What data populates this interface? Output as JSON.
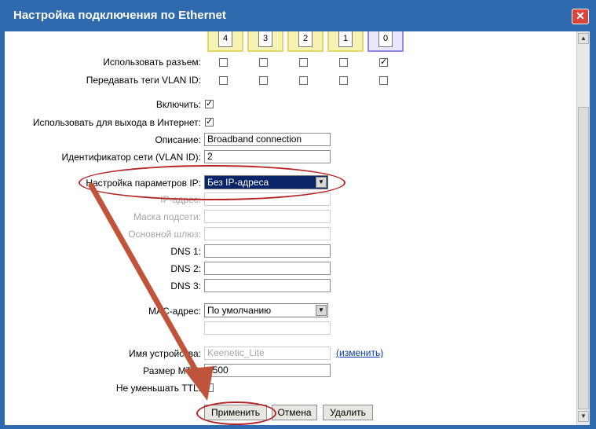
{
  "window": {
    "title": "Настройка подключения по Ethernet",
    "close_glyph": "✕"
  },
  "ports": [
    {
      "label": "4",
      "use": false,
      "vlan_tag": false
    },
    {
      "label": "3",
      "use": false,
      "vlan_tag": false
    },
    {
      "label": "2",
      "use": false,
      "vlan_tag": false
    },
    {
      "label": "1",
      "use": false,
      "vlan_tag": false
    },
    {
      "label": "0",
      "use": true,
      "vlan_tag": false
    }
  ],
  "labels": {
    "use_port": "Использовать разъем:",
    "vlan_tags": "Передавать теги VLAN ID:",
    "enable": "Включить:",
    "internet": "Использовать для выхода в Интернет:",
    "description": "Описание:",
    "vlan_id": "Идентификатор сети (VLAN ID):",
    "ip_settings": "Настройка параметров IP:",
    "ip_address": "IP-адрес:",
    "subnet_mask": "Маска подсети:",
    "gateway": "Основной шлюз:",
    "dns1": "DNS 1:",
    "dns2": "DNS 2:",
    "dns3": "DNS 3:",
    "mac": "MAC-адрес:",
    "device_name": "Имя устройства:",
    "mtu": "Размер MTU:",
    "ttl": "Не уменьшать TTL:"
  },
  "values": {
    "enable": true,
    "internet": true,
    "description": "Broadband connection",
    "vlan_id": "2",
    "ip_settings": "Без IP-адреса",
    "mac": "По умолчанию",
    "device_name": "Keenetic_Lite",
    "mtu": "1500",
    "ttl": false
  },
  "links": {
    "change": "(изменить)"
  },
  "buttons": {
    "apply": "Применить",
    "cancel": "Отмена",
    "delete": "Удалить"
  },
  "scroll": {
    "up": "▲",
    "down": "▼"
  },
  "select_arrow": "▼",
  "colors": {
    "titlebar": "#2f6aaf",
    "close": "#d9443b",
    "annotation": "#b52525",
    "arrow": "#c0543a",
    "selected": "#0a246a"
  }
}
